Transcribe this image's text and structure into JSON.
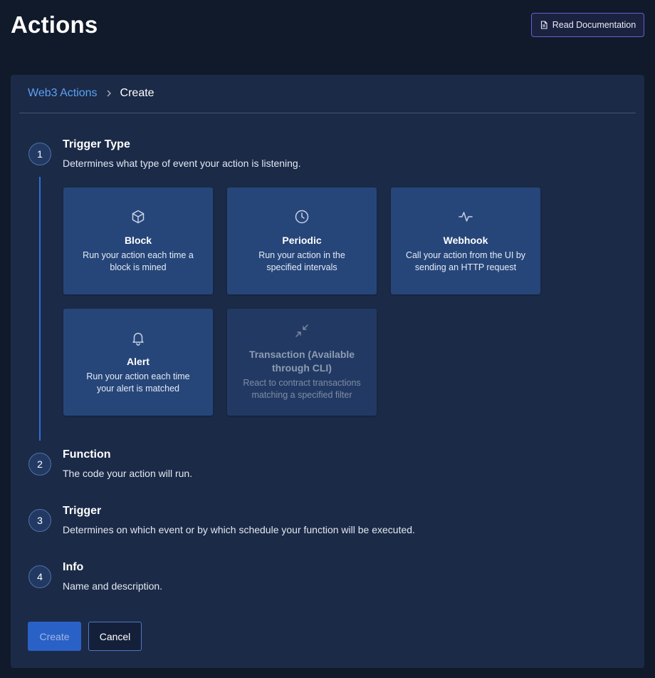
{
  "header": {
    "title": "Actions",
    "doc_button": {
      "label": "Read Documentation",
      "icon": "document-icon"
    }
  },
  "breadcrumb": {
    "parent": "Web3 Actions",
    "current": "Create"
  },
  "steps": [
    {
      "number": "1",
      "title": "Trigger Type",
      "description": "Determines what type of event your action is listening.",
      "active": true
    },
    {
      "number": "2",
      "title": "Function",
      "description": "The code your action will run."
    },
    {
      "number": "3",
      "title": "Trigger",
      "description": "Determines on which event or by which schedule your function will be executed."
    },
    {
      "number": "4",
      "title": "Info",
      "description": "Name and description."
    }
  ],
  "trigger_types": [
    {
      "title": "Block",
      "desc1": "Run your action each time a",
      "desc2": "block is mined",
      "icon": "cube-icon",
      "enabled": true
    },
    {
      "title": "Periodic",
      "desc1": "Run your action in the",
      "desc2": "specified intervals",
      "icon": "clock-icon",
      "enabled": true
    },
    {
      "title": "Webhook",
      "desc1": "Call your action from the UI by",
      "desc2": "sending an HTTP request",
      "icon": "activity-icon",
      "enabled": true
    },
    {
      "title": "Alert",
      "desc1": "Run your action each time",
      "desc2": "your alert is matched",
      "icon": "bell-icon",
      "enabled": true
    },
    {
      "title1": "Transaction (Available",
      "title2": "through CLI)",
      "desc1": "React to contract transactions",
      "desc2": "matching a specified filter",
      "icon": "minimize-arrows-icon",
      "enabled": false
    }
  ],
  "actions": {
    "create_label": "Create",
    "cancel_label": "Cancel"
  },
  "colors": {
    "background": "#111a2a",
    "panel": "#1b2a47",
    "card": "#26467a",
    "accent": "#2e6fd8",
    "link": "#5aa1f5"
  }
}
